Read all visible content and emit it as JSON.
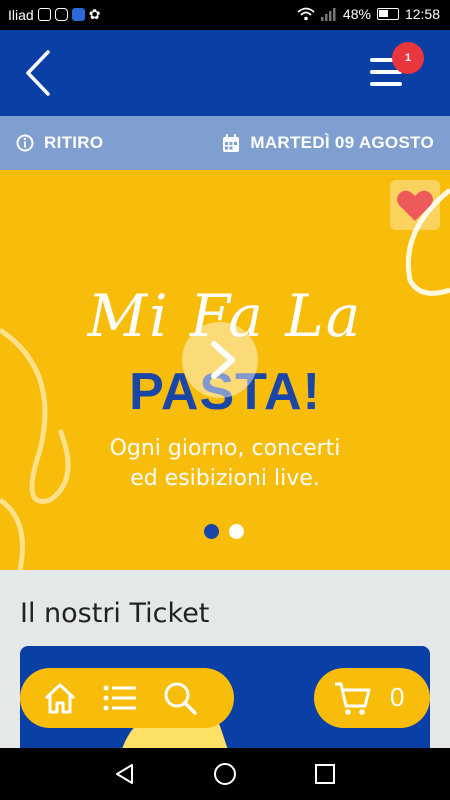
{
  "status_bar": {
    "carrier": "Iliad",
    "battery": "48%",
    "time": "12:58"
  },
  "header": {
    "notification_count": "1"
  },
  "info_bar": {
    "mode_label": "RITIRO",
    "date_label": "MARTEDÌ 09 AGOSTO"
  },
  "banner": {
    "title_script": "Mi Fa La",
    "title_bold": "PASTA!",
    "tagline_line1": "Ogni giorno, concerti",
    "tagline_line2": "ed esibizioni live.",
    "slides_total": 2,
    "active_slide": 1
  },
  "section": {
    "title": "Il nostri Ticket"
  },
  "toolbar": {
    "cart_count": "0"
  },
  "colors": {
    "primary_blue": "#0a3fa6",
    "accent_yellow": "#f8bc0a",
    "info_strip": "#7f9fd0",
    "badge_red": "#e8363c",
    "heart_red": "#ee5a5a"
  },
  "icons": {
    "back": "chevron-left-icon",
    "menu": "hamburger-icon",
    "info": "info-circle-icon",
    "calendar": "calendar-icon",
    "favorite": "heart-icon",
    "play": "play-icon",
    "home": "home-icon",
    "list": "list-icon",
    "search": "search-icon",
    "cart": "cart-icon"
  }
}
